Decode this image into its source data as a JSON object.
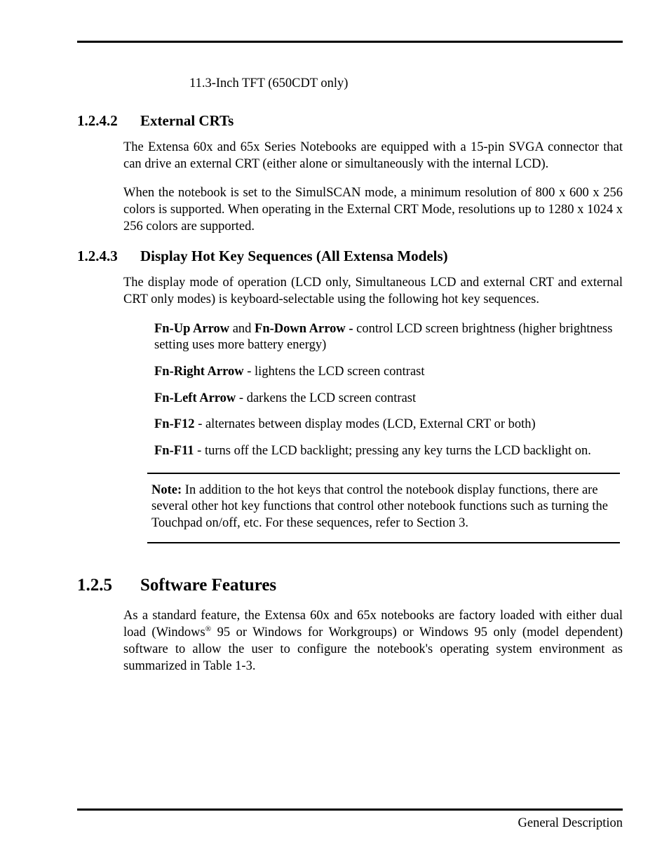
{
  "top_list_item": "11.3-Inch TFT (650CDT only)",
  "sec_1242": {
    "num": "1.2.4.2",
    "title": "External CRTs",
    "p1": "The Extensa 60x and 65x Series Notebooks are equipped with a 15-pin SVGA connector that can drive an external CRT (either alone or simultaneously with the internal LCD).",
    "p2": "When the notebook is set to the SimulSCAN mode, a minimum resolution of 800 x 600 x 256 colors is supported. When operating in the External CRT Mode, resolutions up to 1280 x 1024 x 256 colors are supported."
  },
  "sec_1243": {
    "num": "1.2.4.3",
    "title": "Display Hot Key Sequences (All Extensa Models)",
    "p1": "The display mode of operation (LCD only, Simultaneous LCD and external CRT and external CRT only modes) is keyboard-selectable using the following hot key sequences.",
    "hk1_a": "Fn-Up Arrow",
    "hk1_and": " and ",
    "hk1_b": "Fn-Down Arrow - ",
    "hk1_desc": "control LCD screen brightness (higher brightness setting uses more battery energy)",
    "hk2_k": "Fn-Right Arrow",
    "hk2_desc": "  - lightens the LCD screen contrast",
    "hk3_k": "Fn-Left Arrow",
    "hk3_desc": "  - darkens the LCD screen contrast",
    "hk4_k": "Fn-F12",
    "hk4_desc": " - alternates between display modes (LCD, External CRT or both)",
    "hk5_k": "Fn-F11",
    "hk5_desc": " - turns off the LCD backlight; pressing any key turns the LCD backlight on.",
    "note_label": "Note: ",
    "note_body": "In addition to the hot keys that control the notebook display functions, there are several other hot key functions that control other notebook functions such as turning the Touchpad on/off, etc. For these sequences, refer to Section 3."
  },
  "sec_125": {
    "num": "1.2.5",
    "title": "Software Features",
    "p1_a": "As a standard feature, the Extensa 60x and 65x notebooks are factory loaded with either dual load (Windows",
    "p1_sup": "®",
    "p1_b": " 95 or Windows for Workgroups) or Windows 95 only (model dependent) software to allow the user to configure the notebook's operating system environment as summarized in Table 1-3."
  },
  "footer": "General Description"
}
